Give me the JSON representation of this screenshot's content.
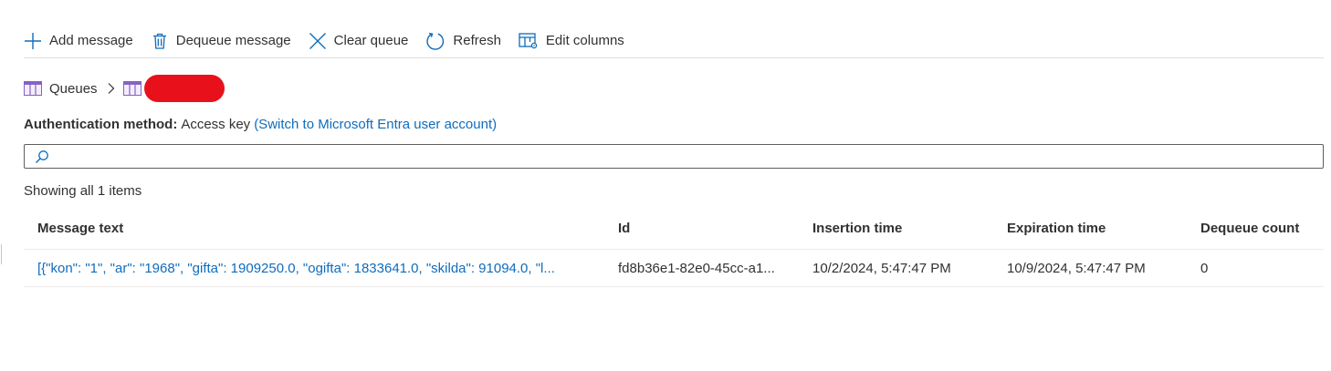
{
  "toolbar": {
    "add": {
      "label": "Add message",
      "icon": "plus-icon"
    },
    "dequeue": {
      "label": "Dequeue message",
      "icon": "trash-icon"
    },
    "clear": {
      "label": "Clear queue",
      "icon": "close-icon"
    },
    "refresh": {
      "label": "Refresh",
      "icon": "refresh-icon"
    },
    "edit_columns": {
      "label": "Edit columns",
      "icon": "edit-columns-icon"
    }
  },
  "breadcrumb": {
    "root": "Queues",
    "current": ""
  },
  "auth": {
    "label": "Authentication method:",
    "value": "Access key",
    "switch_link": "(Switch to Microsoft Entra user account)"
  },
  "search": {
    "value": "",
    "placeholder": ""
  },
  "status": "Showing all 1 items",
  "table": {
    "columns": [
      "Message text",
      "Id",
      "Insertion time",
      "Expiration time",
      "Dequeue count"
    ],
    "rows": [
      {
        "message_text": "[{\"kon\": \"1\", \"ar\": \"1968\", \"gifta\": 1909250.0, \"ogifta\": 1833641.0, \"skilda\": 91094.0, \"l...",
        "id": "fd8b36e1-82e0-45cc-a1...",
        "insertion_time": "10/2/2024, 5:47:47 PM",
        "expiration_time": "10/9/2024, 5:47:47 PM",
        "dequeue_count": "0"
      }
    ]
  },
  "colors": {
    "accent": "#0f6cbd",
    "queue_icon": "#8661c5",
    "redaction": "#e8111b",
    "text": "#323130",
    "divider": "#e1dfdd"
  }
}
